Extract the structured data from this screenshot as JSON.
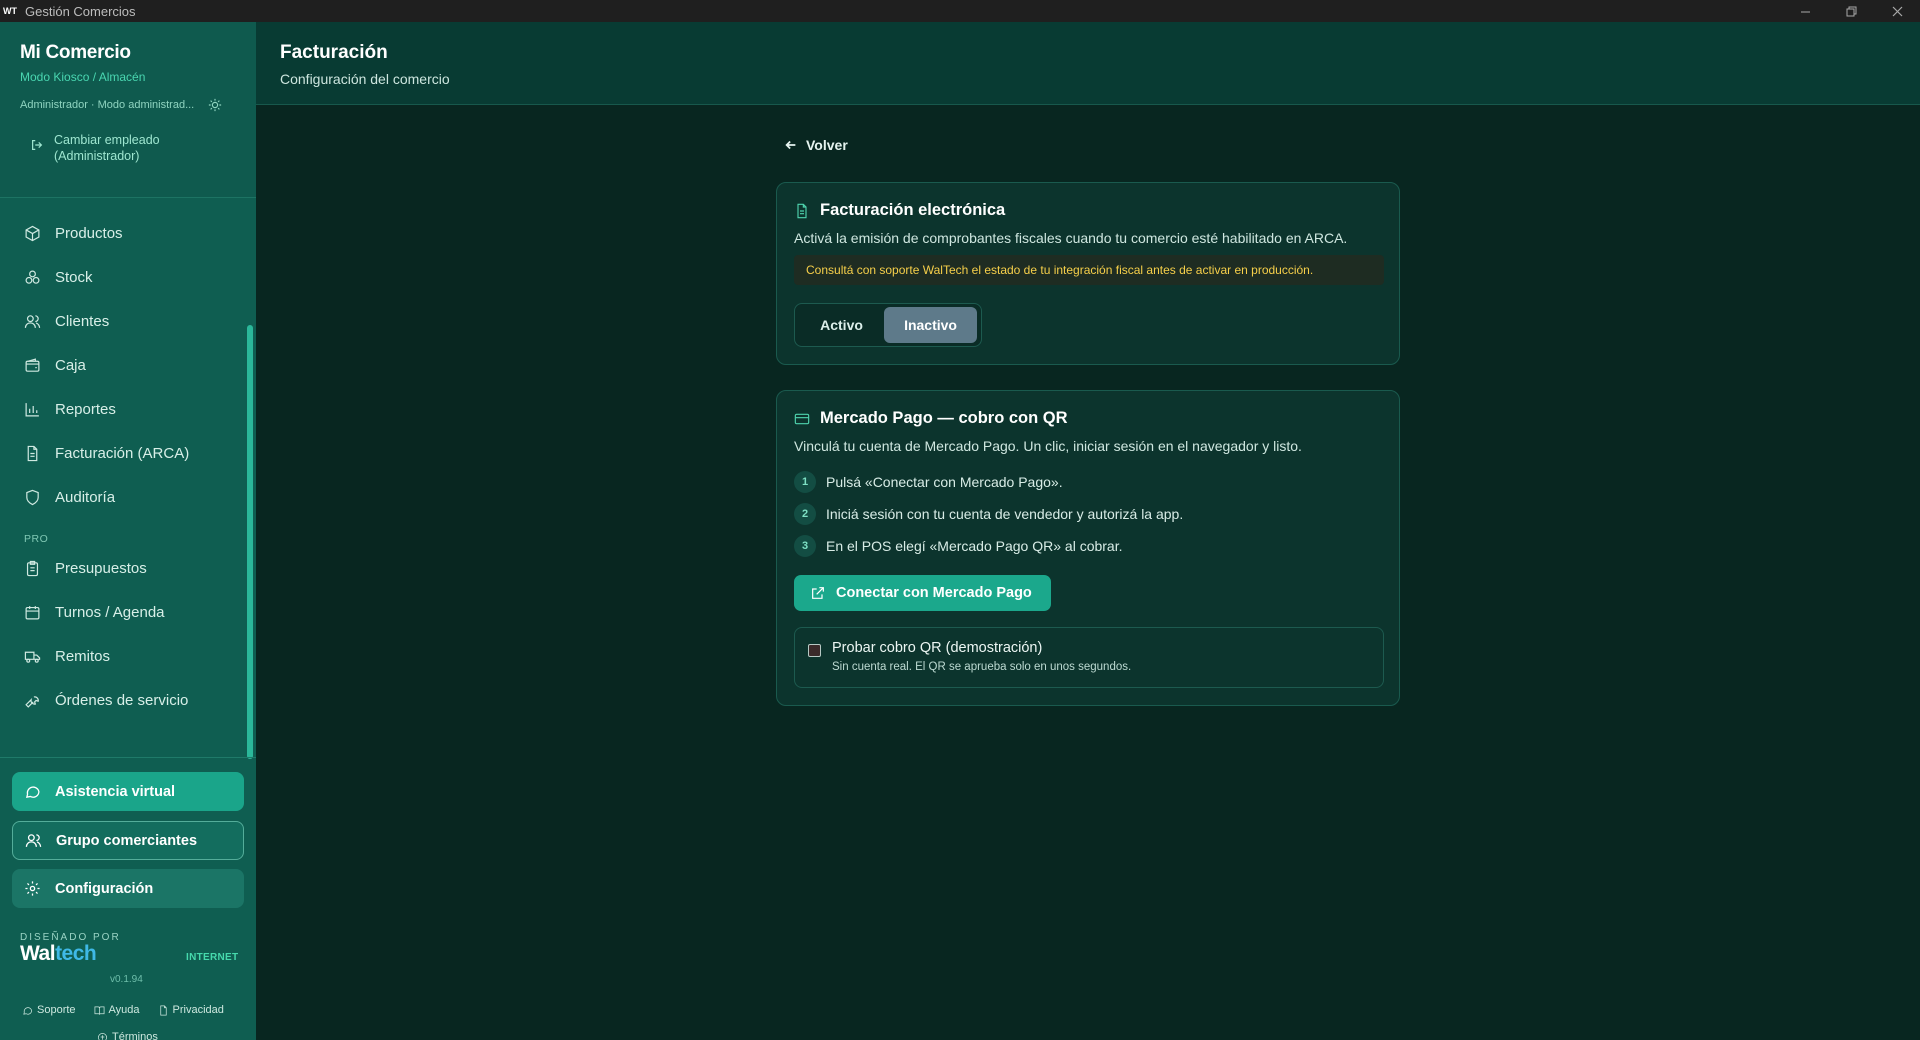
{
  "window": {
    "title": "Gestión Comercios",
    "logo_text": "WT"
  },
  "sidebar": {
    "brand": "Mi Comercio",
    "mode": "Modo Kiosco / Almacén",
    "role": "Administrador · Modo administrad...",
    "switch_employee": [
      "Cambiar empleado",
      "(Administrador)"
    ],
    "items": [
      {
        "label": "Productos",
        "icon": "box-icon"
      },
      {
        "label": "Stock",
        "icon": "boxes-icon"
      },
      {
        "label": "Clientes",
        "icon": "users-icon"
      },
      {
        "label": "Caja",
        "icon": "wallet-icon"
      },
      {
        "label": "Reportes",
        "icon": "bar-chart-icon"
      },
      {
        "label": "Facturación (ARCA)",
        "icon": "document-icon"
      },
      {
        "label": "Auditoría",
        "icon": "shield-icon"
      }
    ],
    "section_pro": "PRO",
    "pro_items": [
      {
        "label": "Presupuestos",
        "icon": "clipboard-icon"
      },
      {
        "label": "Turnos / Agenda",
        "icon": "calendar-icon"
      },
      {
        "label": "Remitos",
        "icon": "truck-icon"
      },
      {
        "label": "Órdenes de servicio",
        "icon": "wrench-icon"
      }
    ],
    "assist_label": "Asistencia virtual",
    "group_label": "Grupo comerciantes",
    "config_label": "Configuración",
    "designed_by": "DISEÑADO POR",
    "logo_part1": "Wal",
    "logo_part2": "tech",
    "connection": "INTERNET",
    "version": "v0.1.94",
    "links": {
      "support": "Soporte",
      "help": "Ayuda",
      "privacy": "Privacidad",
      "terms": "Términos"
    }
  },
  "header": {
    "title": "Facturación",
    "subtitle": "Configuración del comercio"
  },
  "main": {
    "back": "Volver",
    "fe_card": {
      "title": "Facturación electrónica",
      "description": "Activá la emisión de comprobantes fiscales cuando tu comercio esté habilitado en ARCA.",
      "warning": "Consultá con soporte WalTech el estado de tu integración fiscal antes de activar en producción.",
      "toggle_on": "Activo",
      "toggle_off": "Inactivo",
      "selected": "Inactivo"
    },
    "mp_card": {
      "title": "Mercado Pago — cobro con QR",
      "description": "Vinculá tu cuenta de Mercado Pago. Un clic, iniciar sesión en el navegador y listo.",
      "steps": [
        {
          "n": "1",
          "text": "Pulsá «Conectar con Mercado Pago»."
        },
        {
          "n": "2",
          "text": "Iniciá sesión con tu cuenta de vendedor y autorizá la app."
        },
        {
          "n": "3",
          "text": "En el POS elegí «Mercado Pago QR» al cobrar."
        }
      ],
      "connect_label": "Conectar con Mercado Pago",
      "demo_title": "Probar cobro QR (demostración)",
      "demo_sub": "Sin cuenta real. El QR se aprueba solo en unos segundos.",
      "demo_checked": false
    }
  },
  "colors": {
    "accent": "#1ba88c",
    "sidebar": "#0f5e51",
    "background": "#082620",
    "warning": "#f6cf4a"
  }
}
